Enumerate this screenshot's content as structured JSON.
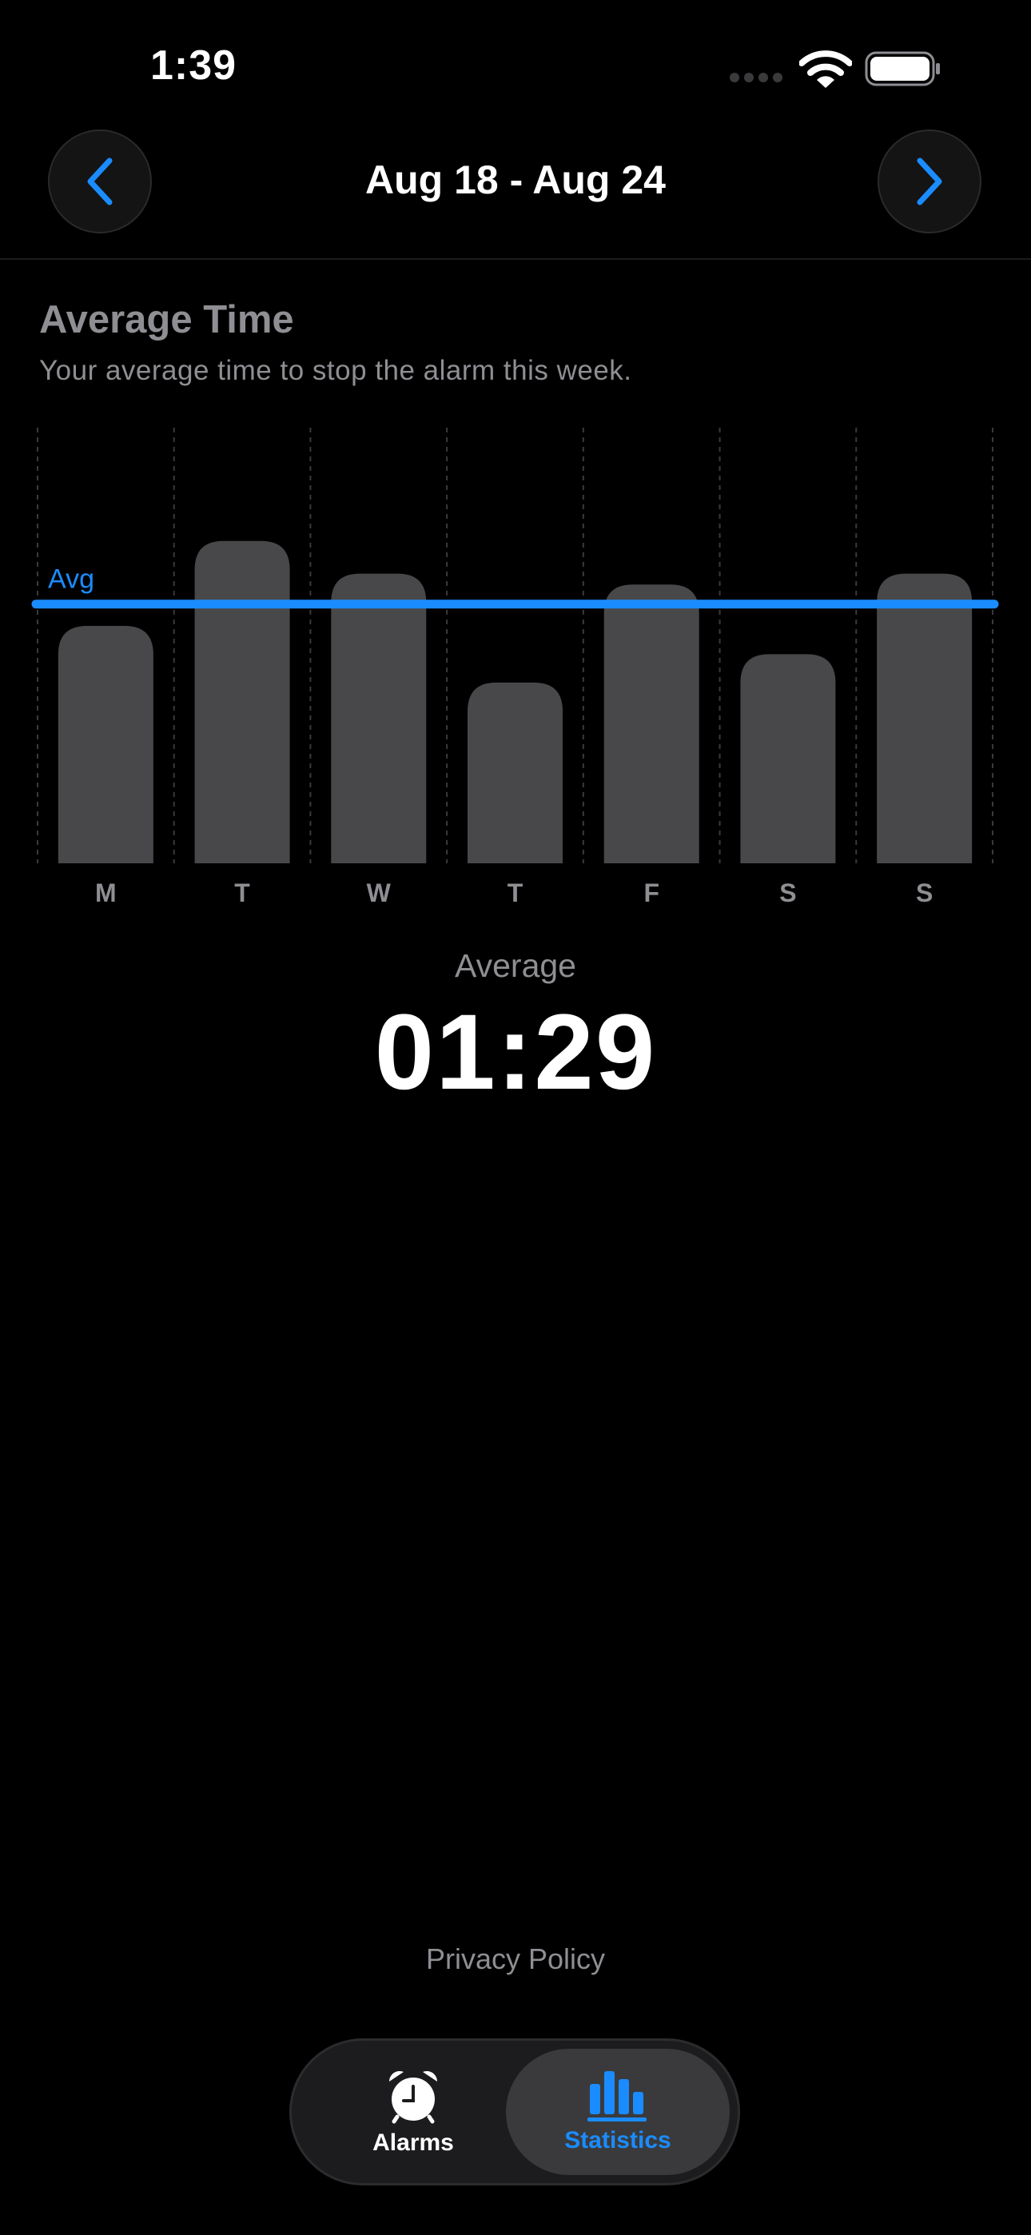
{
  "status_bar": {
    "time": "1:39",
    "signal_icon": "cellular-dots-icon",
    "wifi_icon": "wifi-icon",
    "battery_icon": "battery-full-icon"
  },
  "header": {
    "title": "Aug 18 - Aug 24",
    "prev_icon": "chevron-left-icon",
    "next_icon": "chevron-right-icon",
    "accent_color": "#1a8cff"
  },
  "section": {
    "title": "Average Time",
    "subtitle": "Your average time to stop the alarm this week."
  },
  "chart_data": {
    "type": "bar",
    "categories": [
      "M",
      "T",
      "W",
      "T",
      "F",
      "S",
      "S"
    ],
    "values": [
      0.545,
      0.74,
      0.665,
      0.415,
      0.64,
      0.48,
      0.665
    ],
    "ylim": [
      0,
      1
    ],
    "reference_line": {
      "label": "Avg",
      "value": 0.595,
      "color": "#1a8cff"
    },
    "bar_color": "#48484a",
    "grid": "vertical dashed"
  },
  "summary": {
    "label": "Average",
    "value": "01:29"
  },
  "footer": {
    "privacy_label": "Privacy Policy"
  },
  "tabs": [
    {
      "label": "Alarms",
      "icon": "alarm-clock-icon",
      "selected": false
    },
    {
      "label": "Statistics",
      "icon": "bar-chart-icon",
      "selected": true
    }
  ]
}
